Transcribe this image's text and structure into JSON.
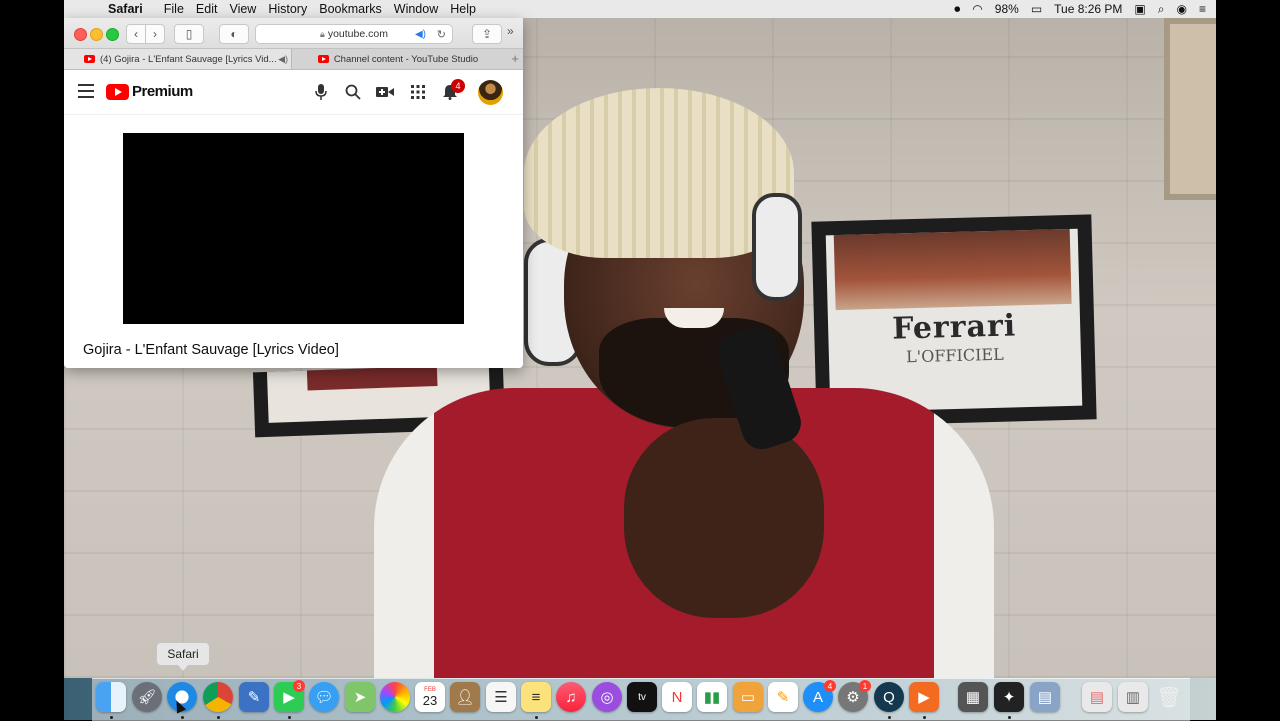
{
  "menubar": {
    "app_name": "Safari",
    "menus": [
      "File",
      "Edit",
      "View",
      "History",
      "Bookmarks",
      "Window",
      "Help"
    ],
    "battery": "98%",
    "clock": "Tue 8:26 PM"
  },
  "browser": {
    "url": "youtube.com",
    "tabs": [
      {
        "title": "(4) Gojira - L'Enfant Sauvage [Lyrics Vid..."
      },
      {
        "title": "Channel content - YouTube Studio"
      }
    ]
  },
  "youtube": {
    "logo_text": "Premium",
    "notification_count": "4",
    "video_title": "Gojira - L'Enfant Sauvage [Lyrics Video]"
  },
  "scene": {
    "poster_logo": "Ferrari",
    "poster_sub": "L'OFFICIEL"
  },
  "dock": {
    "tooltip": "Safari",
    "calendar_month": "FEB",
    "calendar_day": "23",
    "facetime_badge": "3",
    "appstore_badge": "4",
    "settings_badge": "1"
  },
  "colors": {
    "youtube_red": "#ff0000",
    "badge_red": "#cc0000"
  }
}
